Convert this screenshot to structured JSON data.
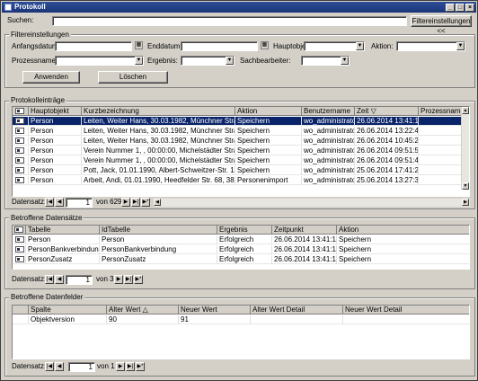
{
  "window": {
    "title": "Protokoll",
    "controls": [
      "_",
      "□",
      "×"
    ]
  },
  "search": {
    "label": "Suchen:",
    "value": "",
    "settings_button": "Filtereinstellungen <<"
  },
  "filter": {
    "title": "Filtereinstellungen",
    "start_label": "Anfangsdatum:",
    "end_label": "Enddatum:",
    "main_object_label": "Hauptobjekt:",
    "action_label": "Aktion:",
    "process_label": "Prozessname:",
    "result_label": "Ergebnis:",
    "clerk_label": "Sachbearbeiter:",
    "apply_button": "Anwenden",
    "delete_button": "Löschen"
  },
  "entries": {
    "title": "Protokolleinträge",
    "columns": [
      "Hauptobjekt",
      "Kurzbezeichnung",
      "Aktion",
      "Benutzername",
      "Zeit",
      "Prozessname"
    ],
    "rows": [
      [
        "Person",
        "Leiten, Weiter Hans, 30.03.1982, Münchner Straße ...",
        "Speichern",
        "wo_administrator",
        "26.06.2014 13:41:15",
        ""
      ],
      [
        "Person",
        "Leiten, Weiter Hans, 30.03.1982, Münchner Straße ...",
        "Speichern",
        "wo_administrator",
        "26.06.2014 13:22:40",
        ""
      ],
      [
        "Person",
        "Leiten, Weiter Hans, 30.03.1982, Münchner Straße ...",
        "Speichern",
        "wo_administrator",
        "26.06.2014 10:45:23",
        ""
      ],
      [
        "Person",
        "Verein Nummer 1, , 00:00:00, Michelstädter Straße 5...",
        "Speichern",
        "wo_administrator",
        "26.06.2014 09:51:53",
        ""
      ],
      [
        "Person",
        "Verein Nummer 1, , 00:00:00, Michelstädter Straße 5...",
        "Speichern",
        "wo_administrator",
        "26.06.2014 09:51:41",
        ""
      ],
      [
        "Person",
        "Pott, Jack, 01.01.1990, Albert-Schweitzer-Str. 159, ...",
        "Speichern",
        "wo_administrator",
        "25.06.2014 17:41:23",
        ""
      ],
      [
        "Person",
        "Arbeit, Andi, 01.01.1990, Heedfelder Str. 68, 38679...",
        "Personenimport",
        "wo_administrator",
        "25.06.2014 13:27:39",
        ""
      ]
    ],
    "nav": {
      "label": "Datensatz:",
      "current": "1",
      "total": "von 629"
    }
  },
  "changed_records": {
    "title": "Betroffene Datensätze",
    "columns": [
      "Tabelle",
      "IdTabelle",
      "Ergebnis",
      "Zeitpunkt",
      "Aktion"
    ],
    "rows": [
      [
        "Person",
        "Person",
        "Erfolgreich",
        "26.06.2014 13:41:15",
        "Speichern"
      ],
      [
        "PersonBankverbindung",
        "PersonBankverbindung",
        "Erfolgreich",
        "26.06.2014 13:41:15",
        "Speichern"
      ],
      [
        "PersonZusatz",
        "PersonZusatz",
        "Erfolgreich",
        "26.06.2014 13:41:15",
        "Speichern"
      ]
    ],
    "nav": {
      "label": "Datensatz:",
      "current": "1",
      "total": "von 3"
    }
  },
  "changed_fields": {
    "title": "Betroffene Datenfelder",
    "columns": [
      "Spalte",
      "Alter Wert",
      "Neuer Wert",
      "Alter Wert Detail",
      "Neuer Wert Detail"
    ],
    "rows": [
      [
        "Objektversion",
        "90",
        "91",
        "",
        ""
      ]
    ],
    "nav": {
      "label": "Datensatz:",
      "current": "1",
      "total": "von 1"
    }
  },
  "colors": {
    "selection": "#0a246a",
    "title_bar": "#1c3578",
    "face": "#d4d0c8"
  }
}
